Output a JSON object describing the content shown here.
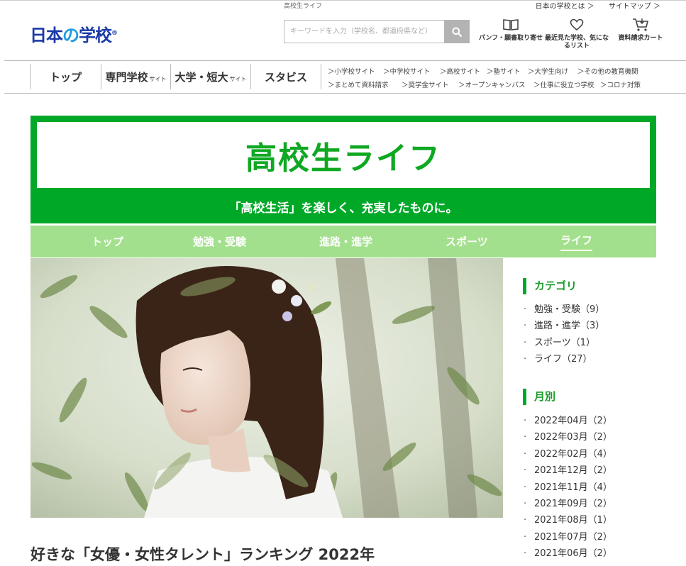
{
  "header": {
    "logo": {
      "part1": "日本",
      "part2": "の",
      "part3": "学校",
      "mark": "®"
    },
    "site_label": "高校生ライフ",
    "top_links": [
      "日本の学校とは ＞",
      "サイトマップ ＞"
    ],
    "search": {
      "placeholder": "キーワードを入力（学校名、都道府県など）"
    },
    "icons": [
      {
        "icon": "book-icon",
        "label": "パンフ・願書取り寄せ"
      },
      {
        "icon": "heart-icon",
        "label": "最近見た学校、気になるリスト"
      },
      {
        "icon": "cart-icon",
        "label": "資料請求カート"
      }
    ]
  },
  "main_nav": [
    {
      "label": "トップ",
      "suffix": ""
    },
    {
      "label": "専門学校",
      "suffix": "サイト"
    },
    {
      "label": "大学・短大",
      "suffix": "サイト"
    },
    {
      "label": "スタビス",
      "suffix": ""
    }
  ],
  "sub_nav": {
    "row1": [
      "＞小学校サイト",
      "＞中学校サイト",
      "＞高校サイト",
      "＞塾サイト",
      "＞大学生向け",
      "＞その他の教育機関"
    ],
    "row2": [
      "＞まとめて資料請求",
      "＞奨学金サイト",
      "＞オープンキャンパス",
      "＞仕事に役立つ学校",
      "＞コロナ対策"
    ]
  },
  "banner": {
    "title": "高校生ライフ",
    "tagline": "「高校生活」を楽しく、充実したものに。"
  },
  "category_nav": [
    {
      "label": "トップ",
      "active": false
    },
    {
      "label": "勉強・受験",
      "active": false
    },
    {
      "label": "進路・進学",
      "active": false
    },
    {
      "label": "スポーツ",
      "active": false
    },
    {
      "label": "ライフ",
      "active": true
    }
  ],
  "article": {
    "title": "好きな「女優・女性タレント」ランキング 2022年"
  },
  "sidebar": {
    "categories_heading": "カテゴリ",
    "categories": [
      "勉強・受験（9）",
      "進路・進学（3）",
      "スポーツ（1）",
      "ライフ（27）"
    ],
    "monthly_heading": "月別",
    "months": [
      "2022年04月（2）",
      "2022年03月（2）",
      "2022年02月（4）",
      "2021年12月（2）",
      "2021年11月（4）",
      "2021年09月（2）",
      "2021年08月（1）",
      "2021年07月（2）",
      "2021年06月（2）"
    ]
  },
  "colors": {
    "green": "#00a828",
    "light_green": "#a3e08d",
    "logo_blue": "#1a3aa8"
  }
}
